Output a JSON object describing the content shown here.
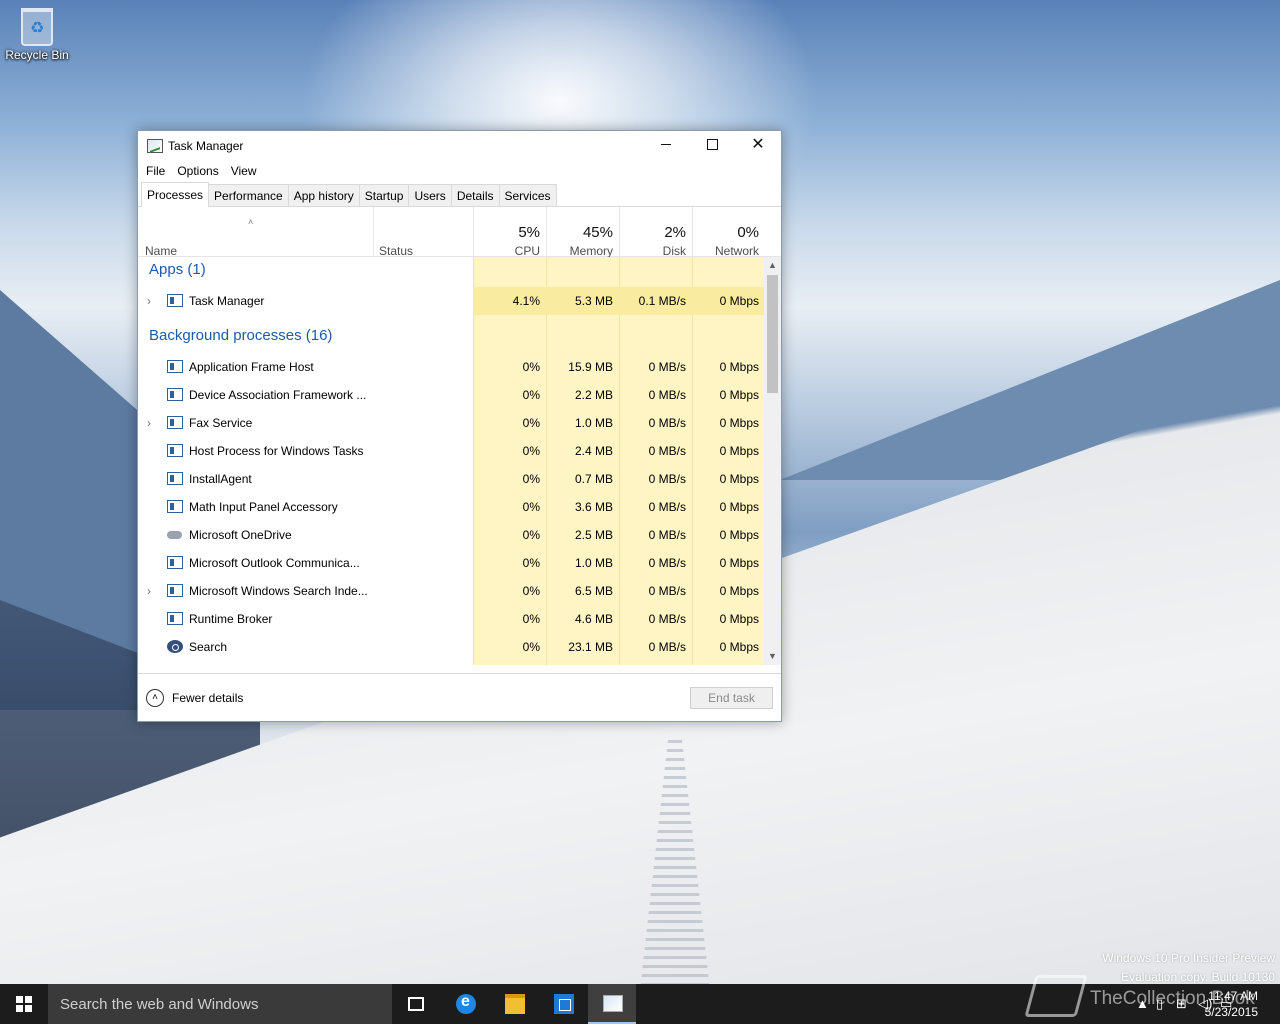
{
  "desktop": {
    "recycle_bin_label": "Recycle Bin",
    "watermark_line1": "Windows 10 Pro Insider Preview",
    "watermark_line2": "Evaluation copy. Build 10130",
    "brand_watermark": "TheCollection Book"
  },
  "window": {
    "title": "Task Manager",
    "icon": "task-manager-icon",
    "menu": [
      "File",
      "Options",
      "View"
    ],
    "tabs": [
      "Processes",
      "Performance",
      "App history",
      "Startup",
      "Users",
      "Details",
      "Services"
    ],
    "active_tab": "Processes"
  },
  "columns": {
    "name": "Name",
    "status": "Status",
    "cpu": {
      "percent": "5%",
      "label": "CPU"
    },
    "memory": {
      "percent": "45%",
      "label": "Memory"
    },
    "disk": {
      "percent": "2%",
      "label": "Disk"
    },
    "network": {
      "percent": "0%",
      "label": "Network"
    }
  },
  "groups": {
    "apps": "Apps (1)",
    "background": "Background processes (16)"
  },
  "apps": [
    {
      "name": "Task Manager",
      "cpu": "4.1%",
      "memory": "5.3 MB",
      "disk": "0.1 MB/s",
      "network": "0 Mbps",
      "expandable": true
    }
  ],
  "background": [
    {
      "name": "Application Frame Host",
      "cpu": "0%",
      "memory": "15.9 MB",
      "disk": "0 MB/s",
      "network": "0 Mbps"
    },
    {
      "name": "Device Association Framework ...",
      "cpu": "0%",
      "memory": "2.2 MB",
      "disk": "0 MB/s",
      "network": "0 Mbps"
    },
    {
      "name": "Fax Service",
      "cpu": "0%",
      "memory": "1.0 MB",
      "disk": "0 MB/s",
      "network": "0 Mbps",
      "expandable": true
    },
    {
      "name": "Host Process for Windows Tasks",
      "cpu": "0%",
      "memory": "2.4 MB",
      "disk": "0 MB/s",
      "network": "0 Mbps"
    },
    {
      "name": "InstallAgent",
      "cpu": "0%",
      "memory": "0.7 MB",
      "disk": "0 MB/s",
      "network": "0 Mbps"
    },
    {
      "name": "Math Input Panel Accessory",
      "cpu": "0%",
      "memory": "3.6 MB",
      "disk": "0 MB/s",
      "network": "0 Mbps"
    },
    {
      "name": "Microsoft OneDrive",
      "cpu": "0%",
      "memory": "2.5 MB",
      "disk": "0 MB/s",
      "network": "0 Mbps"
    },
    {
      "name": "Microsoft Outlook Communica...",
      "cpu": "0%",
      "memory": "1.0 MB",
      "disk": "0 MB/s",
      "network": "0 Mbps"
    },
    {
      "name": "Microsoft Windows Search Inde...",
      "cpu": "0%",
      "memory": "6.5 MB",
      "disk": "0 MB/s",
      "network": "0 Mbps",
      "expandable": true
    },
    {
      "name": "Runtime Broker",
      "cpu": "0%",
      "memory": "4.6 MB",
      "disk": "0 MB/s",
      "network": "0 Mbps"
    },
    {
      "name": "Search",
      "cpu": "0%",
      "memory": "23.1 MB",
      "disk": "0 MB/s",
      "network": "0 Mbps"
    }
  ],
  "footer": {
    "fewer_details": "Fewer details",
    "end_task": "End task"
  },
  "taskbar": {
    "search_placeholder": "Search the web and Windows",
    "time": "11:47 AM",
    "date": "5/23/2015"
  }
}
